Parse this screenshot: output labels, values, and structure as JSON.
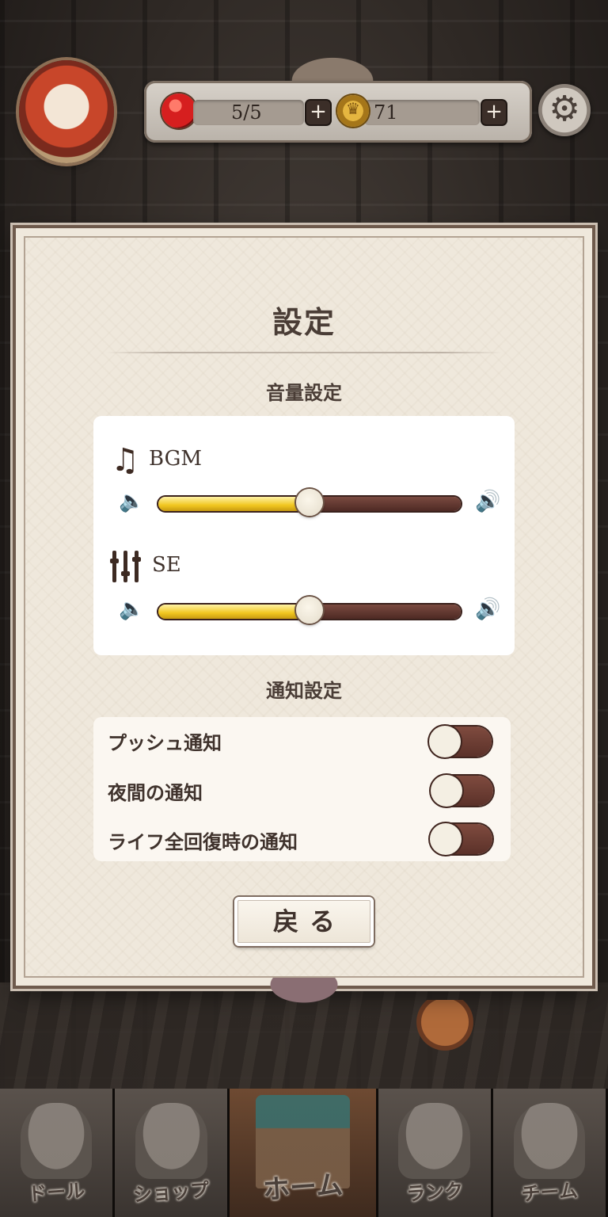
{
  "header": {
    "life": "5/5",
    "coins": "71",
    "plus": "+",
    "settings_glyph": "⚙"
  },
  "dialog": {
    "title": "設定",
    "volume": {
      "heading": "音量設定",
      "bgm": {
        "label": "BGM",
        "level": 0.5
      },
      "se": {
        "label": "SE",
        "level": 0.5
      },
      "mute_glyph": "🔈",
      "loud_glyph": "🔊",
      "note_glyph": "♫"
    },
    "notifications": {
      "heading": "通知設定",
      "items": [
        {
          "label": "プッシュ通知",
          "on": false
        },
        {
          "label": "夜間の通知",
          "on": false
        },
        {
          "label": "ライフ全回復時の通知",
          "on": false
        }
      ]
    },
    "back_label": "戻る"
  },
  "nav": {
    "tabs": [
      {
        "label": "ドール",
        "active": false
      },
      {
        "label": "ショップ",
        "active": false
      },
      {
        "label": "ホーム",
        "active": true
      },
      {
        "label": "ランク",
        "active": false
      },
      {
        "label": "チーム",
        "active": false
      }
    ]
  }
}
